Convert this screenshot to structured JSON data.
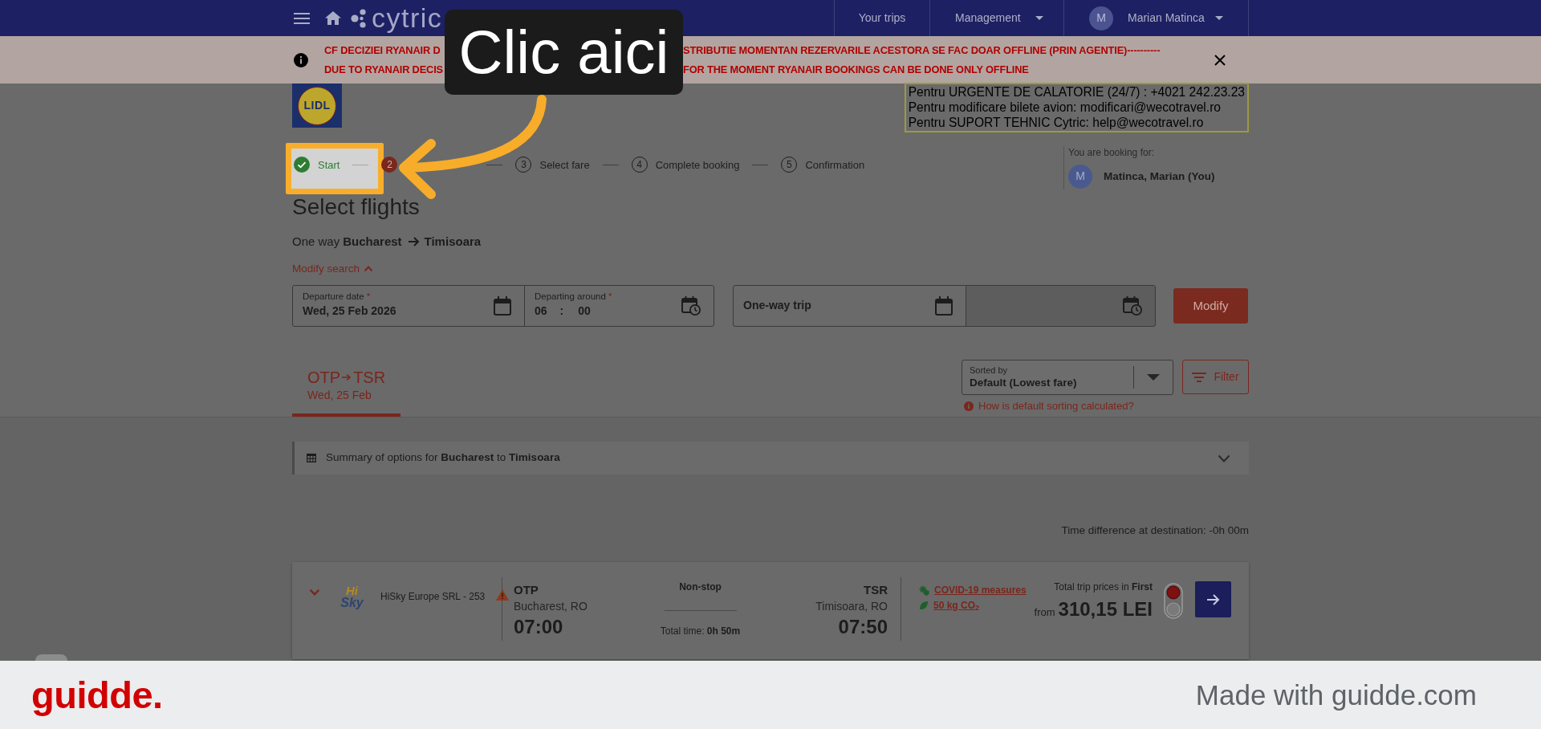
{
  "navbar": {
    "logo_text": "cytric",
    "items": [
      {
        "kind": "link",
        "label": "Your trips"
      },
      {
        "kind": "menu",
        "label": "Management"
      },
      {
        "kind": "user",
        "initial": "M",
        "label": "Marian Matinca"
      }
    ]
  },
  "notice": {
    "lines": [
      {
        "before": "CF DECIZIEI RYANAIR D",
        "after": "STRIBUTIE MOMENTAN REZERVARILE ACESTORA SE FAC DOAR OFFLINE (PRIN AGENTIE)----------"
      },
      {
        "before": "DUE TO RYANAIR DECIS",
        "after": "FOR THE MOMENT RYANAIR BOOKINGS CAN BE DONE ONLY OFFLINE"
      }
    ]
  },
  "company_logo": {
    "text": "LIDL"
  },
  "contact_box": {
    "lines": [
      "Pentru URGENTE DE CALATORIE (24/7) : +4021 242.23.23",
      "Pentru modificare bilete avion: modificari@wecotravel.ro",
      "Pentru SUPORT TEHNIC Cytric: help@wecotravel.ro"
    ]
  },
  "stepper": [
    {
      "label": "Start",
      "completed": true,
      "current": false
    },
    {
      "number": "2",
      "completed": false,
      "current": true
    },
    {
      "number": "3",
      "label": "Select fare",
      "completed": false,
      "current": false
    },
    {
      "number": "4",
      "label": "Complete booking",
      "completed": false,
      "current": false
    },
    {
      "number": "5",
      "label": "Confirmation",
      "completed": false,
      "current": false
    }
  ],
  "booking_for": {
    "caption": "You are booking for:",
    "initial": "M",
    "name": "Matinca, Marian (You)"
  },
  "page_title": "Select flights",
  "route": {
    "trip_type": "One way",
    "origin": "Bucharest",
    "destination": "Timisoara"
  },
  "modify_search": {
    "label": "Modify search",
    "expanded": true
  },
  "search_form": {
    "required_mark": "*",
    "departure_date": {
      "label": "Departure date",
      "required": true,
      "value": "Wed, 25 Feb 2026"
    },
    "departing_around": {
      "label": "Departing around",
      "required": true,
      "hours": "06",
      "separator": ":",
      "minutes": "00"
    },
    "trip_type": {
      "label": "One-way trip"
    },
    "return_date": {
      "disabled": true
    },
    "submit": "Modify"
  },
  "tabs": [
    {
      "origin": "OTP",
      "destination": "TSR",
      "date": "Wed, 25 Feb",
      "selected": true
    }
  ],
  "sort": {
    "label": "Sorted by",
    "value": "Default (Lowest fare)",
    "help_link": "How is default sorting calculated?"
  },
  "filter_button": "Filter",
  "summary": {
    "text": "Summary of options for **Bucharest** to **Timisoara**",
    "expanded": false
  },
  "time_difference": "Time difference at destination: -0h 00m",
  "flights": [
    {
      "expanded": false,
      "airline_logo": {
        "top": "Hi",
        "bottom": "Sky"
      },
      "airline": "HiSky Europe SRL - 253",
      "warning": true,
      "departure": {
        "code": "OTP",
        "city": "Bucharest, RO",
        "time": "07:00"
      },
      "stops": "Non-stop",
      "duration": "Total time: **0h 50m**",
      "arrival": {
        "code": "TSR",
        "city": "Timisoara, RO",
        "time": "07:50"
      },
      "notes": [
        {
          "kind": "covid",
          "text": "COVID-19 measures"
        },
        {
          "kind": "co2",
          "text": "50 kg CO$_{2}$"
        }
      ],
      "price_caption": "Total trip prices in **First**",
      "price_prefix": "from",
      "price": "310,15 LEI",
      "lights": [
        {
          "on": true
        },
        {
          "on": false
        }
      ]
    }
  ],
  "annotation": {
    "callout": "Clic aici"
  },
  "footer": {
    "logo": "guidde.",
    "tagline": "Made with guidde.com"
  }
}
